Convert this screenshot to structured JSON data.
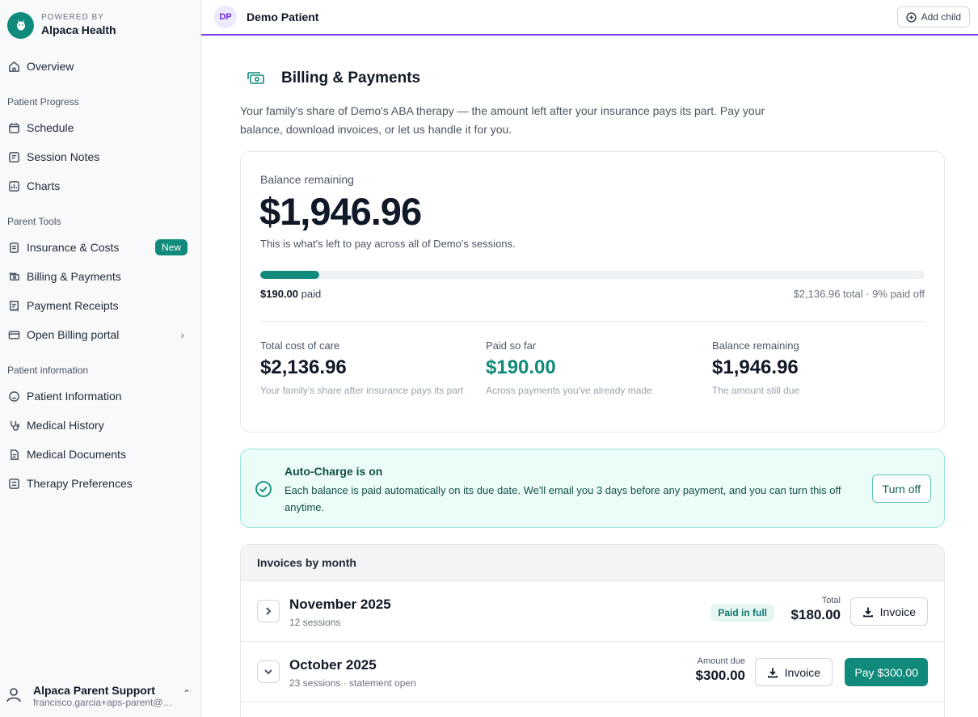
{
  "brand": {
    "powered_by": "POWERED BY",
    "name": "Alpaca Health"
  },
  "sidebar": {
    "overview": "Overview",
    "sections": [
      {
        "label": "Patient Progress",
        "items": [
          "Schedule",
          "Session Notes",
          "Charts"
        ]
      },
      {
        "label": "Parent Tools",
        "items": [
          "Insurance & Costs",
          "Billing & Payments",
          "Payment Receipts",
          "Open Billing portal"
        ]
      },
      {
        "label": "Patient information",
        "items": [
          "Patient Information",
          "Medical History",
          "Medical Documents",
          "Therapy Preferences"
        ]
      }
    ],
    "new_badge": "New",
    "user": {
      "name": "Alpaca Parent Support",
      "email": "francisco.garcia+aps-parent@alpacahealth.io"
    }
  },
  "topbar": {
    "initials": "DP",
    "patient": "Demo Patient",
    "add_child": "Add child"
  },
  "page": {
    "title": "Billing & Payments",
    "description": "Your family's share of Demo's ABA therapy — the amount left after your insurance pays its part. Pay your balance, download invoices, or let us handle it for you."
  },
  "balance": {
    "label": "Balance remaining",
    "amount": "$1,946.96",
    "note": "This is what's left to pay across all of Demo's sessions.",
    "progress_fraction": 0.089,
    "paid_amount": "$190.00",
    "paid_word": "paid",
    "total_line": "$2,136.96 total · 9% paid off"
  },
  "stats": [
    {
      "label": "Total cost of care",
      "value": "$2,136.96",
      "note": "Your family's share after insurance pays its part"
    },
    {
      "label": "Paid so far",
      "value": "$190.00",
      "note": "Across payments you've already made"
    },
    {
      "label": "Balance remaining",
      "value": "$1,946.96",
      "note": "The amount still due"
    }
  ],
  "autocharge": {
    "title": "Auto-Charge is on",
    "text": "Each balance is paid automatically on its due date. We'll email you 3 days before any payment, and you can turn this off anytime.",
    "button": "Turn off"
  },
  "invoices": {
    "header": "Invoices by month",
    "rows": [
      {
        "month": "November 2025",
        "sub": "12 sessions",
        "badge": "Paid in full",
        "amount_label": "Total",
        "amount": "$180.00",
        "invoice_label": "Invoice"
      },
      {
        "month": "October 2025",
        "sub": "23 sessions · statement open",
        "amount_label": "Amount due",
        "amount": "$300.00",
        "invoice_label": "Invoice",
        "pay_label": "Pay $300.00"
      }
    ]
  },
  "colors": {
    "accent": "#0f8a7b",
    "topbar_border": "#7c3aed"
  }
}
